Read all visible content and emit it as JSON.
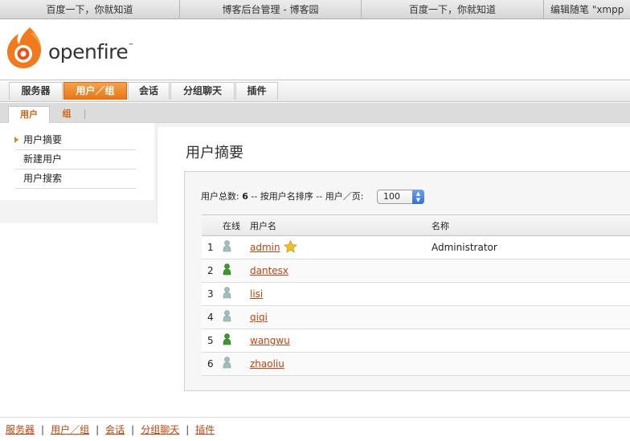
{
  "browser_tabs": [
    "百度一下，你就知道",
    "博客后台管理 - 博客园",
    "百度一下，你就知道",
    "编辑随笔 \"xmpp"
  ],
  "brand": {
    "name": "openfire",
    "tm": "™"
  },
  "main_nav": [
    "服务器",
    "用户／组",
    "会话",
    "分组聊天",
    "插件"
  ],
  "main_nav_active": "用户／组",
  "sub_nav": [
    "用户",
    "组"
  ],
  "sidebar": [
    "用户摘要",
    "新建用户",
    "用户搜索"
  ],
  "page_title": "用户摘要",
  "summary": {
    "prefix": "用户总数: ",
    "count": "6",
    "suffix": " -- 按用户名排序 -- 用户／页: ",
    "per_page": "100"
  },
  "table": {
    "headers": [
      "",
      "在线",
      "用户名",
      "名称"
    ],
    "rows": [
      {
        "num": "1",
        "online": false,
        "username": "admin",
        "name": "Administrator",
        "admin": true
      },
      {
        "num": "2",
        "online": true,
        "username": "dantesx",
        "name": ""
      },
      {
        "num": "3",
        "online": false,
        "username": "lisi",
        "name": ""
      },
      {
        "num": "4",
        "online": false,
        "username": "qiqi",
        "name": ""
      },
      {
        "num": "5",
        "online": true,
        "username": "wangwu",
        "name": ""
      },
      {
        "num": "6",
        "online": false,
        "username": "zhaoliu",
        "name": ""
      }
    ]
  },
  "footer_links": [
    "服务器",
    "用户／组",
    "会话",
    "分组聊天",
    "插件"
  ],
  "colors": {
    "accent": "#e67514",
    "link": "#c4420c",
    "online": "#3a9a2a",
    "offline": "#9fbfbf"
  }
}
